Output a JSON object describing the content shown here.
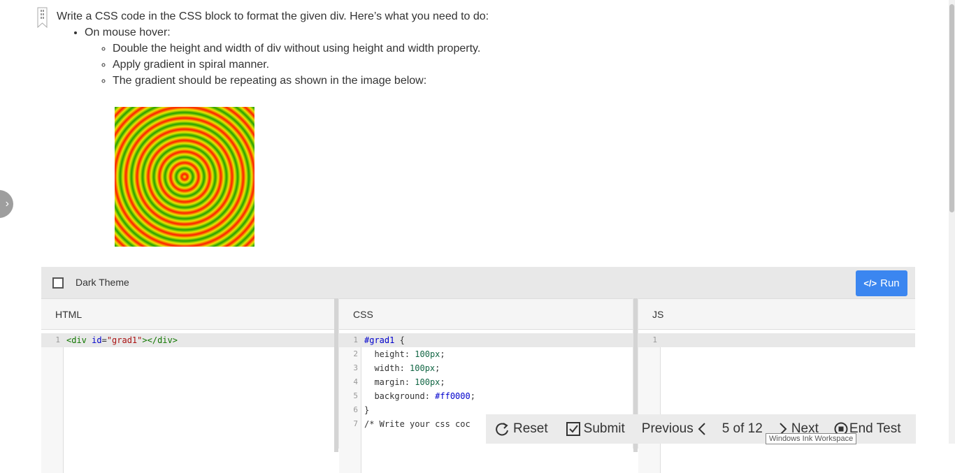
{
  "question": {
    "intro": "Write a CSS code in the CSS block to format the given div. Here’s what you need to do:",
    "bullet": "On mouse hover:",
    "subbullets": [
      "Double the height and width of div without using height and width property.",
      "Apply gradient in spiral manner.",
      "The gradient should be repeating as shown in the image below:"
    ]
  },
  "toolbar": {
    "dark_theme_label": "Dark Theme",
    "run_label": "Run"
  },
  "panes": {
    "html": {
      "title": "HTML"
    },
    "css": {
      "title": "CSS"
    },
    "js": {
      "title": "JS"
    }
  },
  "code": {
    "html_lines": [
      {
        "n": "1",
        "text": "<div id=\"grad1\"></div>"
      }
    ],
    "css_lines": [
      {
        "n": "1",
        "text": "#grad1 {"
      },
      {
        "n": "2",
        "text": "  height: 100px;"
      },
      {
        "n": "3",
        "text": "  width: 100px;"
      },
      {
        "n": "4",
        "text": "  margin: 100px;"
      },
      {
        "n": "5",
        "text": "  background: #ff0000;"
      },
      {
        "n": "6",
        "text": "}"
      },
      {
        "n": "7",
        "text": "/* Write your css coc"
      }
    ],
    "js_lines": [
      {
        "n": "1",
        "text": ""
      }
    ]
  },
  "bottom_bar": {
    "reset": "Reset",
    "submit": "Submit",
    "previous": "Previous",
    "page": "5 of 12",
    "next": "Next",
    "end_test": "End Test"
  },
  "tooltip": "Windows Ink Workspace",
  "colors": {
    "run_button": "#3b86f0",
    "gradient_colors": [
      "#e8e800",
      "#ff1a00",
      "#22a000"
    ]
  },
  "icons": [
    "chevron-right-icon",
    "bookmark-icon",
    "code-icon",
    "reset-icon",
    "checkbox-icon",
    "chevron-left-icon",
    "stop-icon"
  ]
}
